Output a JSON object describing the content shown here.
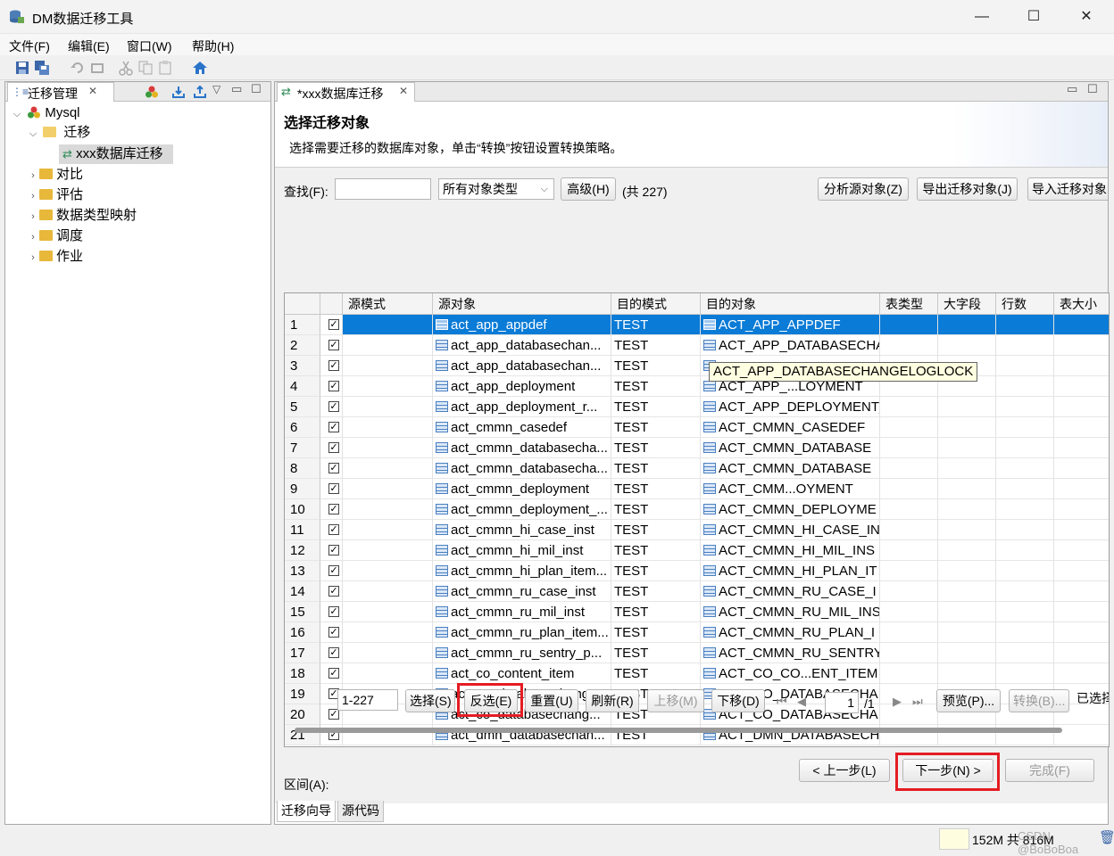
{
  "window": {
    "title": "DM数据迁移工具",
    "min": "—",
    "max": "☐",
    "close": "✕"
  },
  "menu": [
    "文件(F)",
    "编辑(E)",
    "窗口(W)",
    "帮助(H)"
  ],
  "left_panel": {
    "tab_label": "迁移管理",
    "tree": {
      "root": "Mysql",
      "migration": "迁移",
      "migration_item": "xxx数据库迁移",
      "folders": [
        "对比",
        "评估",
        "数据类型映射",
        "调度",
        "作业"
      ]
    }
  },
  "editor_tab": "*xxx数据库迁移",
  "wizard": {
    "title": "选择迁移对象",
    "description": "选择需要迁移的数据库对象，单击“转换”按钮设置转换策略。"
  },
  "filter": {
    "search_label": "查找(F):",
    "search_value": "",
    "type_select": "所有对象类型",
    "advanced_button": "高级(H)",
    "count": "(共 227)",
    "analyze_button": "分析源对象(Z)",
    "export_button": "导出迁移对象(J)",
    "import_button": "导入迁移对象"
  },
  "table": {
    "columns": [
      "",
      "",
      "源模式",
      "源对象",
      "目的模式",
      "目的对象",
      "表类型",
      "大字段",
      "行数",
      "表大小"
    ],
    "rows": [
      {
        "n": "1",
        "src": "act_app_appdef",
        "dst_schema": "TEST",
        "dst": "ACT_APP_APPDEF"
      },
      {
        "n": "2",
        "src": "act_app_databasechan...",
        "dst_schema": "TEST",
        "dst": "ACT_APP_DATABASECHA"
      },
      {
        "n": "3",
        "src": "act_app_databasechan...",
        "dst_schema": "TEST",
        "dst": ""
      },
      {
        "n": "4",
        "src": "act_app_deployment",
        "dst_schema": "TEST",
        "dst": "ACT_APP_...LOYMENT"
      },
      {
        "n": "5",
        "src": "act_app_deployment_r...",
        "dst_schema": "TEST",
        "dst": "ACT_APP_DEPLOYMENT_"
      },
      {
        "n": "6",
        "src": "act_cmmn_casedef",
        "dst_schema": "TEST",
        "dst": "ACT_CMMN_CASEDEF"
      },
      {
        "n": "7",
        "src": "act_cmmn_databasecha...",
        "dst_schema": "TEST",
        "dst": "ACT_CMMN_DATABASE"
      },
      {
        "n": "8",
        "src": "act_cmmn_databasecha...",
        "dst_schema": "TEST",
        "dst": "ACT_CMMN_DATABASE"
      },
      {
        "n": "9",
        "src": "act_cmmn_deployment",
        "dst_schema": "TEST",
        "dst": "ACT_CMM...OYMENT"
      },
      {
        "n": "10",
        "src": "act_cmmn_deployment_...",
        "dst_schema": "TEST",
        "dst": "ACT_CMMN_DEPLOYME"
      },
      {
        "n": "11",
        "src": "act_cmmn_hi_case_inst",
        "dst_schema": "TEST",
        "dst": "ACT_CMMN_HI_CASE_IN"
      },
      {
        "n": "12",
        "src": "act_cmmn_hi_mil_inst",
        "dst_schema": "TEST",
        "dst": "ACT_CMMN_HI_MIL_INS"
      },
      {
        "n": "13",
        "src": "act_cmmn_hi_plan_item...",
        "dst_schema": "TEST",
        "dst": "ACT_CMMN_HI_PLAN_IT"
      },
      {
        "n": "14",
        "src": "act_cmmn_ru_case_inst",
        "dst_schema": "TEST",
        "dst": "ACT_CMMN_RU_CASE_I"
      },
      {
        "n": "15",
        "src": "act_cmmn_ru_mil_inst",
        "dst_schema": "TEST",
        "dst": "ACT_CMMN_RU_MIL_INS"
      },
      {
        "n": "16",
        "src": "act_cmmn_ru_plan_item...",
        "dst_schema": "TEST",
        "dst": "ACT_CMMN_RU_PLAN_I"
      },
      {
        "n": "17",
        "src": "act_cmmn_ru_sentry_p...",
        "dst_schema": "TEST",
        "dst": "ACT_CMMN_RU_SENTRY"
      },
      {
        "n": "18",
        "src": "act_co_content_item",
        "dst_schema": "TEST",
        "dst": "ACT_CO_CO...ENT_ITEM"
      },
      {
        "n": "19",
        "src": "act_co_databasechang...",
        "dst_schema": "TEST",
        "dst": "ACT_CO_DATABASECHA"
      },
      {
        "n": "20",
        "src": "act_co_databasechang...",
        "dst_schema": "TEST",
        "dst": "ACT_CO_DATABASECHA"
      },
      {
        "n": "21",
        "src": "act_dmn_databasechan...",
        "dst_schema": "TEST",
        "dst": "ACT_DMN_DATABASECH"
      }
    ],
    "tooltip": "ACT_APP_DATABASECHANGELOGLOCK"
  },
  "range_bar": {
    "label": "区间(A):",
    "value": "1-227",
    "select": "选择(S)",
    "invert": "反选(E)",
    "reset": "重置(U)",
    "refresh": "刷新(R)",
    "up": "上移(M)",
    "down": "下移(D)",
    "page": "1",
    "page_total": "/1",
    "preview": "预览(P)...",
    "convert": "转换(B)...",
    "selected": "已选择"
  },
  "nav": {
    "back": "< 上一步(L)",
    "next": "下一步(N) >",
    "finish": "完成(F)"
  },
  "bottom_tabs": [
    "迁移向导",
    "源代码"
  ],
  "status": {
    "memory": "152M 共 816M",
    "watermark": "CSDN @BoBoBoa"
  }
}
